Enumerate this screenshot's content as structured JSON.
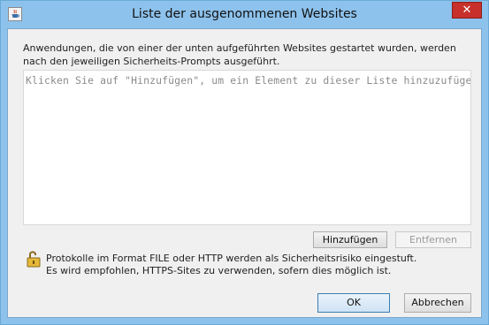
{
  "window": {
    "title": "Liste der ausgenommenen Websites",
    "close_glyph": "✕",
    "app_icon": "java-cup-icon"
  },
  "description": "Anwendungen, die von einer der unten aufgeführten Websites gestartet wurden, werden nach den jeweiligen Sicherheits-Prompts ausgeführt.",
  "site_list": {
    "placeholder": "Klicken Sie auf \"Hinzufügen\", um ein Element zu dieser Liste hinzuzufügen",
    "items": []
  },
  "buttons": {
    "add": "Hinzufügen",
    "remove": "Entfernen",
    "ok": "OK",
    "cancel": "Abbrechen"
  },
  "warning": {
    "icon": "unlocked-padlock-icon",
    "line1": "Protokolle im Format FILE oder HTTP werden als Sicherheitsrisiko eingestuft.",
    "line2": "Es wird empfohlen, HTTPS-Sites zu verwenden, sofern dies möglich ist."
  },
  "colors": {
    "titlebar": "#8dc2ec",
    "close_button": "#c7302b",
    "client_background": "#f0f0f0"
  }
}
